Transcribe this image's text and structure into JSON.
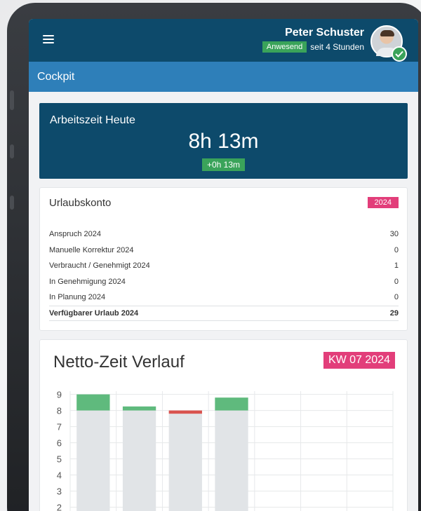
{
  "header": {
    "user_name": "Peter Schuster",
    "status_badge": "Anwesend",
    "status_since": "seit 4 Stunden",
    "menu_icon": "hamburger-icon",
    "status_icon": "check-icon"
  },
  "page": {
    "title": "Cockpit"
  },
  "work_today": {
    "title": "Arbeitszeit Heute",
    "time": "8h 13m",
    "delta": "+0h 13m"
  },
  "vacation": {
    "title": "Urlaubskonto",
    "year_badge": "2024",
    "rows": [
      {
        "label": "Anspruch 2024",
        "value": "30"
      },
      {
        "label": "Manuelle Korrektur 2024",
        "value": "0"
      },
      {
        "label": "Verbraucht / Genehmigt 2024",
        "value": "1"
      },
      {
        "label": "In Genehmigung 2024",
        "value": "0"
      },
      {
        "label": "In Planung 2024",
        "value": "0"
      }
    ],
    "total": {
      "label": "Verfügbarer Urlaub 2024",
      "value": "29"
    }
  },
  "net_time": {
    "title": "Netto-Zeit Verlauf",
    "week_badge": "KW 07 2024"
  },
  "chart_data": {
    "type": "bar",
    "title": "Netto-Zeit Verlauf",
    "yticks": [
      "9",
      "8",
      "7",
      "6",
      "5",
      "4",
      "3",
      "2"
    ],
    "ylim": [
      1.4,
      9.2
    ],
    "grid": true,
    "stacked": true,
    "colors": {
      "base": "#e1e4e7",
      "over": "#5fba7d",
      "under": "#d9534f"
    },
    "bars": [
      {
        "base": 8,
        "over": 1.0,
        "under": 0
      },
      {
        "base": 8,
        "over": 0.25,
        "under": 0
      },
      {
        "base": 7.8,
        "over": 0,
        "under": 0.2
      },
      {
        "base": 8,
        "over": 0.8,
        "under": 0
      },
      {
        "base": 0,
        "over": 0,
        "under": 0
      },
      {
        "base": 0,
        "over": 0,
        "under": 0
      },
      {
        "base": 0,
        "over": 0,
        "under": 0
      }
    ]
  }
}
